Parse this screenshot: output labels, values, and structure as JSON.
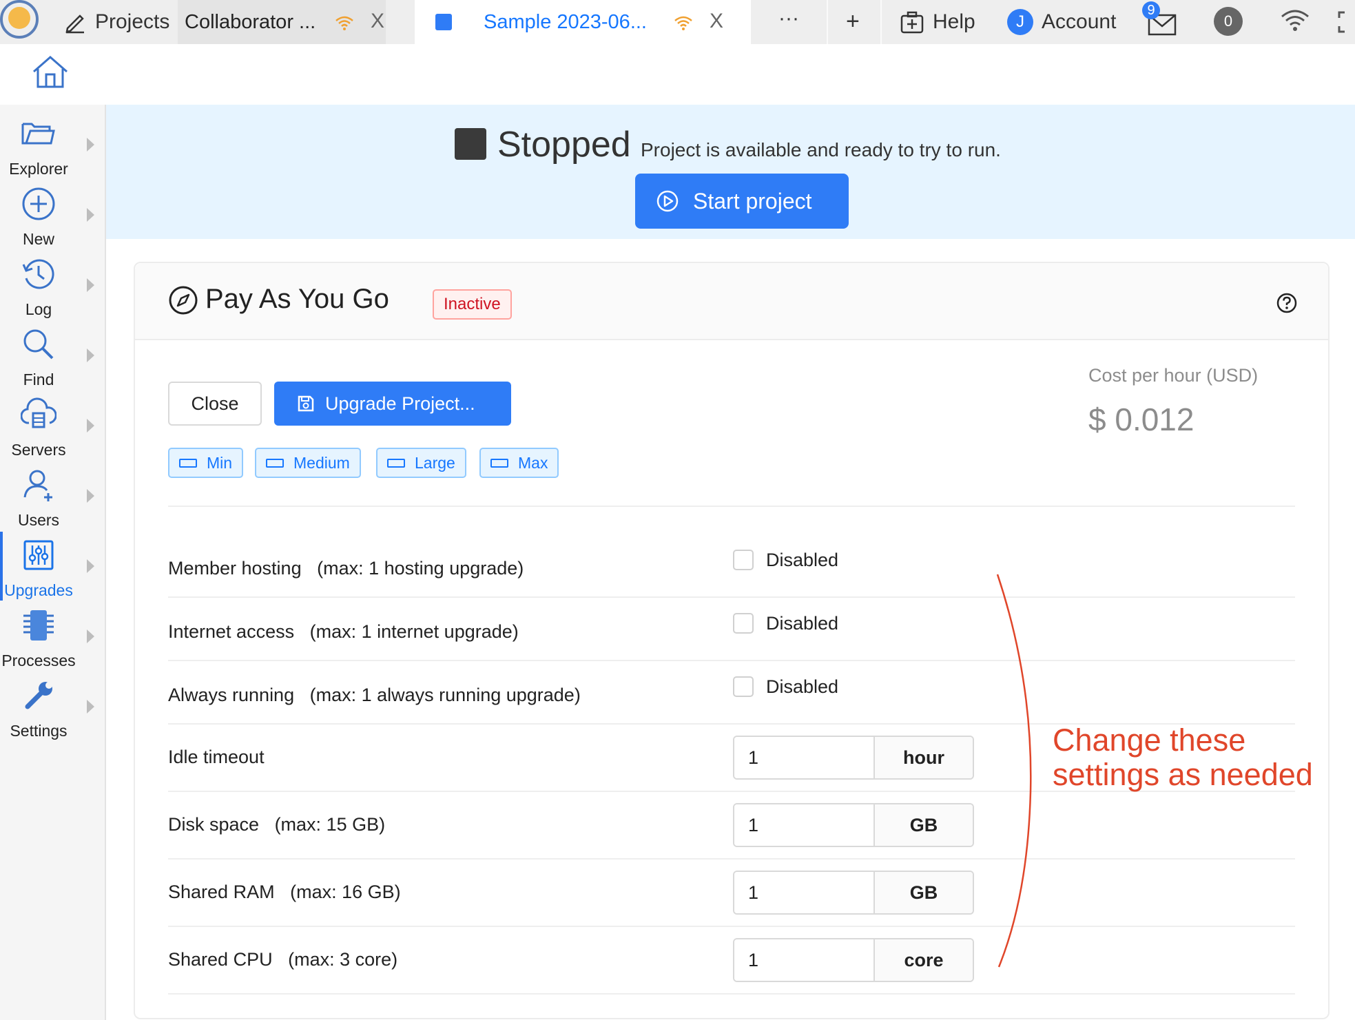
{
  "topbar": {
    "projects_label": "Projects",
    "tabs": [
      {
        "title": "Collaborator ...",
        "close": "X"
      },
      {
        "title": "Sample 2023-06...",
        "close": "X"
      }
    ],
    "more_label": "···",
    "add_label": "+",
    "help_label": "Help",
    "account_initial": "J",
    "account_label": "Account",
    "mail_badge": "9",
    "notif_count": "0"
  },
  "sidebar": {
    "items": [
      {
        "label": "Explorer",
        "icon": "folder-open-icon"
      },
      {
        "label": "New",
        "icon": "plus-circle-icon"
      },
      {
        "label": "Log",
        "icon": "history-icon"
      },
      {
        "label": "Find",
        "icon": "search-icon"
      },
      {
        "label": "Servers",
        "icon": "cloud-server-icon"
      },
      {
        "label": "Users",
        "icon": "users-icon"
      },
      {
        "label": "Upgrades",
        "icon": "sliders-icon",
        "active": true
      },
      {
        "label": "Processes",
        "icon": "chip-icon"
      },
      {
        "label": "Settings",
        "icon": "wrench-icon"
      }
    ]
  },
  "status": {
    "state": "Stopped",
    "message": "Project is available and ready to try to run.",
    "start_label": "Start project"
  },
  "card": {
    "title": "Pay As You Go",
    "badge": "Inactive",
    "close_label": "Close",
    "upgrade_label": "Upgrade Project...",
    "presets": [
      "Min",
      "Medium",
      "Large",
      "Max"
    ],
    "cost_label": "Cost per hour (USD)",
    "cost_value": "$ 0.012",
    "toggles": [
      {
        "label": "Member hosting",
        "max": "(max: 1 hosting upgrade)",
        "state": "Disabled"
      },
      {
        "label": "Internet access",
        "max": "(max: 1 internet upgrade)",
        "state": "Disabled"
      },
      {
        "label": "Always running",
        "max": "(max: 1 always running upgrade)",
        "state": "Disabled"
      }
    ],
    "quotas": [
      {
        "label": "Idle timeout",
        "max": "",
        "value": "1",
        "unit": "hour"
      },
      {
        "label": "Disk space",
        "max": "(max: 15 GB)",
        "value": "1",
        "unit": "GB"
      },
      {
        "label": "Shared RAM",
        "max": "(max: 16 GB)",
        "value": "1",
        "unit": "GB"
      },
      {
        "label": "Shared CPU",
        "max": "(max: 3 core)",
        "value": "1",
        "unit": "core"
      }
    ]
  },
  "annotation": {
    "line1": "Change these",
    "line2": "settings as needed",
    "color": "#e0462a"
  },
  "colors": {
    "accent": "#2f7cf6",
    "banner": "#e6f4ff",
    "inactive": "#cf1322"
  }
}
